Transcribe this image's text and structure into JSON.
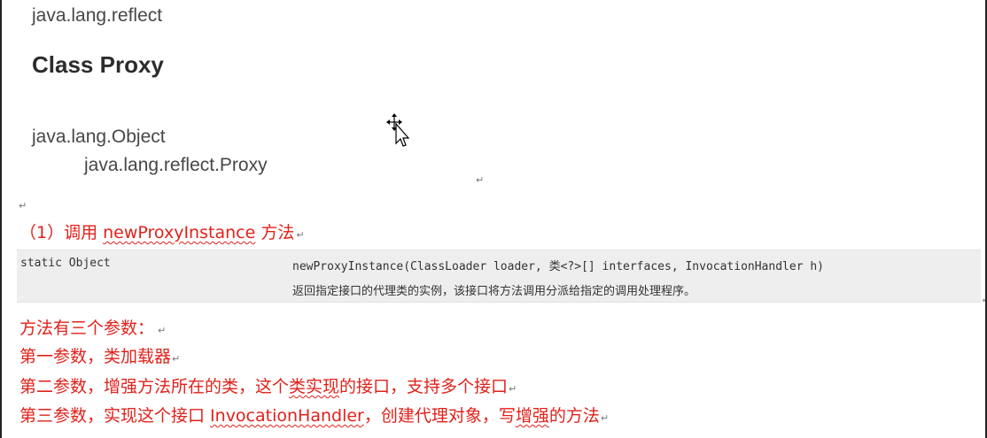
{
  "header": {
    "package": "java.lang.reflect",
    "class_title": "Class Proxy"
  },
  "hierarchy": {
    "parent": "java.lang.Object",
    "child": "java.lang.reflect.Proxy"
  },
  "marks": {
    "para": "↵"
  },
  "step1": {
    "prefix": "（1）调用 ",
    "method": "newProxyInstance",
    "suffix": " 方法"
  },
  "api": {
    "modifier": "static Object",
    "signature": "newProxyInstance(ClassLoader loader, 类<?>[] interfaces, InvocationHandler h)",
    "description": "返回指定接口的代理类的实例，该接口将方法调用分派给指定的调用处理程序。"
  },
  "notes": {
    "line1": "方法有三个参数：",
    "line2": "第一参数，类加载器",
    "line3_a": "第二参数，增强方法所在的类，这个",
    "line3_b": "类实现",
    "line3_c": "的接口，支持多个接口",
    "line4_a": "第三参数，实现这个接口 ",
    "line4_b": "InvocationHandler",
    "line4_c": "，创建代理对象，写",
    "line4_d": "增强",
    "line4_e": "的方法"
  }
}
